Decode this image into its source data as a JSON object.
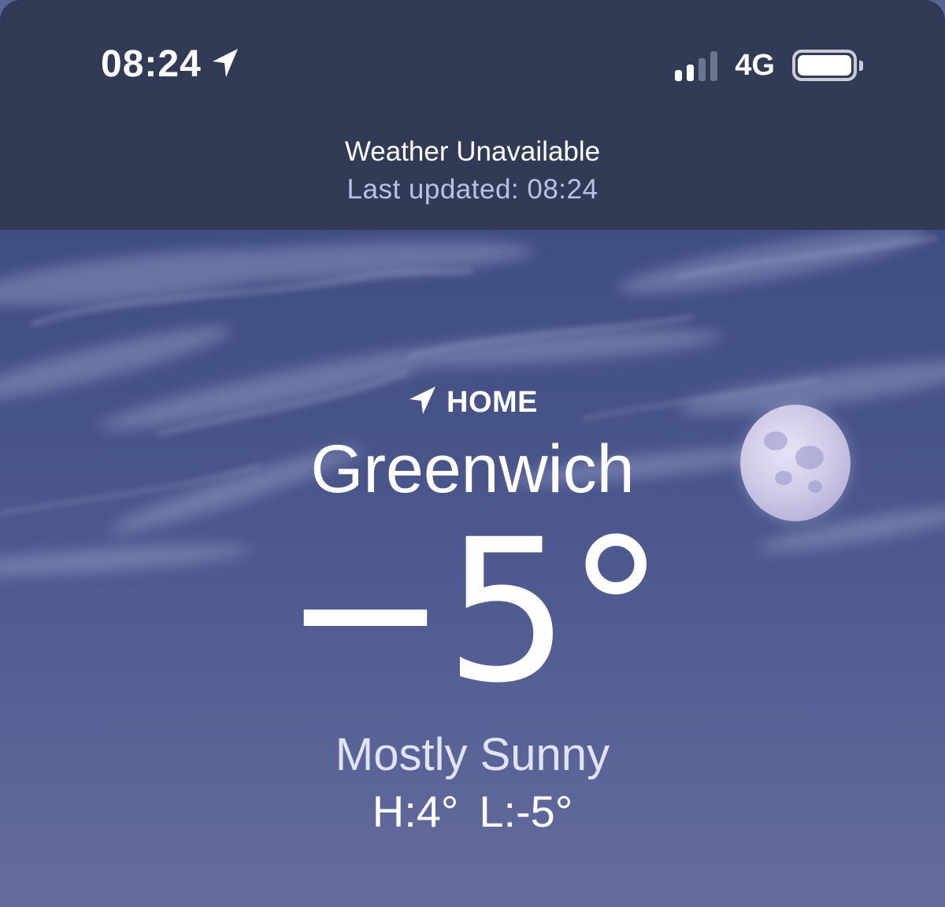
{
  "status_bar": {
    "time": "08:24",
    "location_icon": "location-arrow-icon",
    "signal_bars_active": 2,
    "signal_bars_total": 4,
    "network": "4G",
    "battery_level": 1.0
  },
  "banner": {
    "title": "Weather Unavailable",
    "subtitle": "Last updated: 08:24"
  },
  "weather": {
    "location_label": "HOME",
    "location_icon": "location-arrow-icon",
    "city": "Greenwich",
    "temperature": "−5°",
    "condition": "Mostly Sunny",
    "high": "H:4°",
    "low": "L:-5°"
  },
  "colors": {
    "banner_bg": "#323b56",
    "sky_top": "#3f4d82",
    "sky_bottom": "#646c9c",
    "subtitle_text": "#b9c2e3",
    "condition_text": "#dfe4fb"
  }
}
